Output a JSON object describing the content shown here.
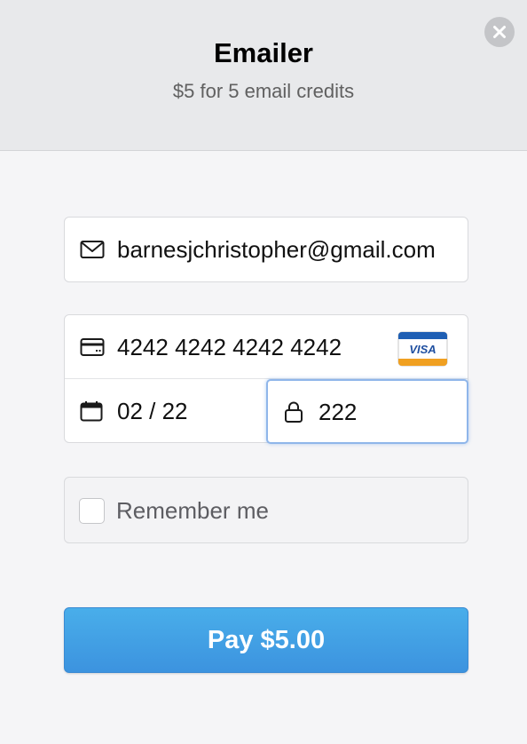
{
  "header": {
    "title": "Emailer",
    "subtitle": "$5 for 5 email credits",
    "close_icon": "close-icon"
  },
  "form": {
    "email": {
      "value": "barnesjchristopher@gmail.com",
      "icon": "envelope-icon"
    },
    "card_number": {
      "value": "4242 4242 4242 4242",
      "icon": "credit-card-icon",
      "brand": "VISA"
    },
    "expiry": {
      "value": "02 / 22",
      "icon": "calendar-icon"
    },
    "cvc": {
      "value": "222",
      "icon": "lock-icon",
      "focused": true
    },
    "remember": {
      "label": "Remember me",
      "checked": false
    }
  },
  "pay_button": {
    "label": "Pay $5.00"
  },
  "colors": {
    "accent": "#3c9ae3",
    "header_bg": "#e8e9eb",
    "body_bg": "#f5f5f7",
    "focus_border": "#8fb6ea"
  }
}
